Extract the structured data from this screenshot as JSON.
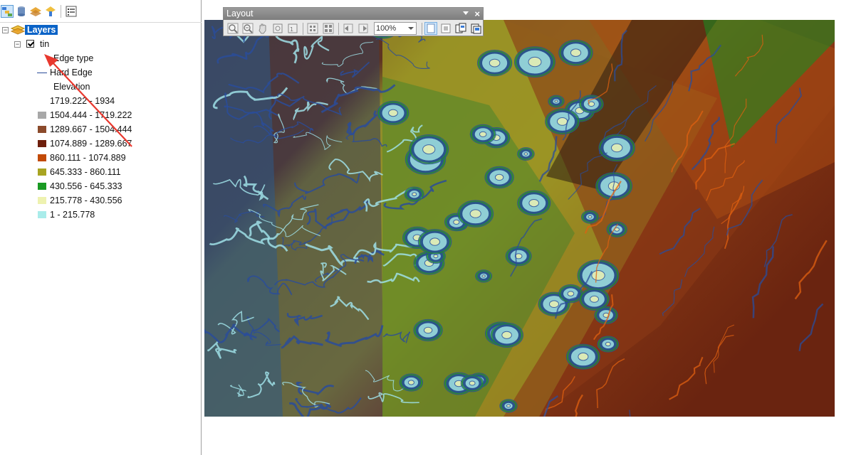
{
  "toc": {
    "root_label": "Layers",
    "layer": {
      "name": "tin",
      "checked": true
    },
    "edge_heading": "Edge type",
    "edge_item": "Hard Edge",
    "elevation_heading": "Elevation",
    "classes": [
      {
        "label": "1719.222 - 1934",
        "color": "#ffffff"
      },
      {
        "label": "1504.444 - 1719.222",
        "color": "#a8a8a8"
      },
      {
        "label": "1289.667 - 1504.444",
        "color": "#8b4a2b"
      },
      {
        "label": "1074.889 - 1289.667",
        "color": "#6e1f0c"
      },
      {
        "label": "860.111 - 1074.889",
        "color": "#c24a06"
      },
      {
        "label": "645.333 - 860.111",
        "color": "#a8a422"
      },
      {
        "label": "430.556 - 645.333",
        "color": "#1a9a23"
      },
      {
        "label": "215.778 - 430.556",
        "color": "#eef2b0"
      },
      {
        "label": "1 - 215.778",
        "color": "#a9ecea"
      }
    ]
  },
  "layout_toolbar": {
    "title": "Layout",
    "zoom_value": "100%"
  },
  "colors": {
    "accent": "#0a63c7",
    "edge_line": "#2a4c9a",
    "annotation_arrow": "#e8382e"
  }
}
